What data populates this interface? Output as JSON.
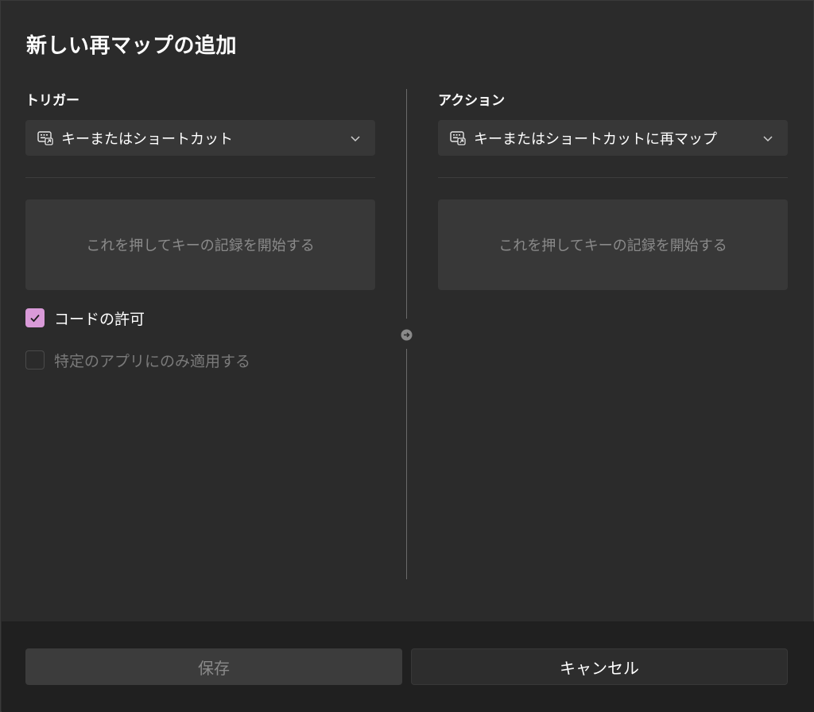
{
  "dialog": {
    "title": "新しい再マップの追加"
  },
  "trigger": {
    "label": "トリガー",
    "dropdown": {
      "icon": "keyboard-icon",
      "selected": "キーまたはショートカット"
    },
    "record_prompt": "これを押してキーの記録を開始する",
    "options": [
      {
        "label": "コードの許可",
        "checked": true,
        "enabled": true
      },
      {
        "label": "特定のアプリにのみ適用する",
        "checked": false,
        "enabled": false
      }
    ]
  },
  "action": {
    "label": "アクション",
    "dropdown": {
      "icon": "keyboard-icon",
      "selected": "キーまたはショートカットに再マップ"
    },
    "record_prompt": "これを押してキーの記録を開始する"
  },
  "footer": {
    "save_label": "保存",
    "cancel_label": "キャンセル"
  },
  "colors": {
    "accent": "#d99ad8",
    "background": "#2b2b2b",
    "footer": "#202020"
  }
}
